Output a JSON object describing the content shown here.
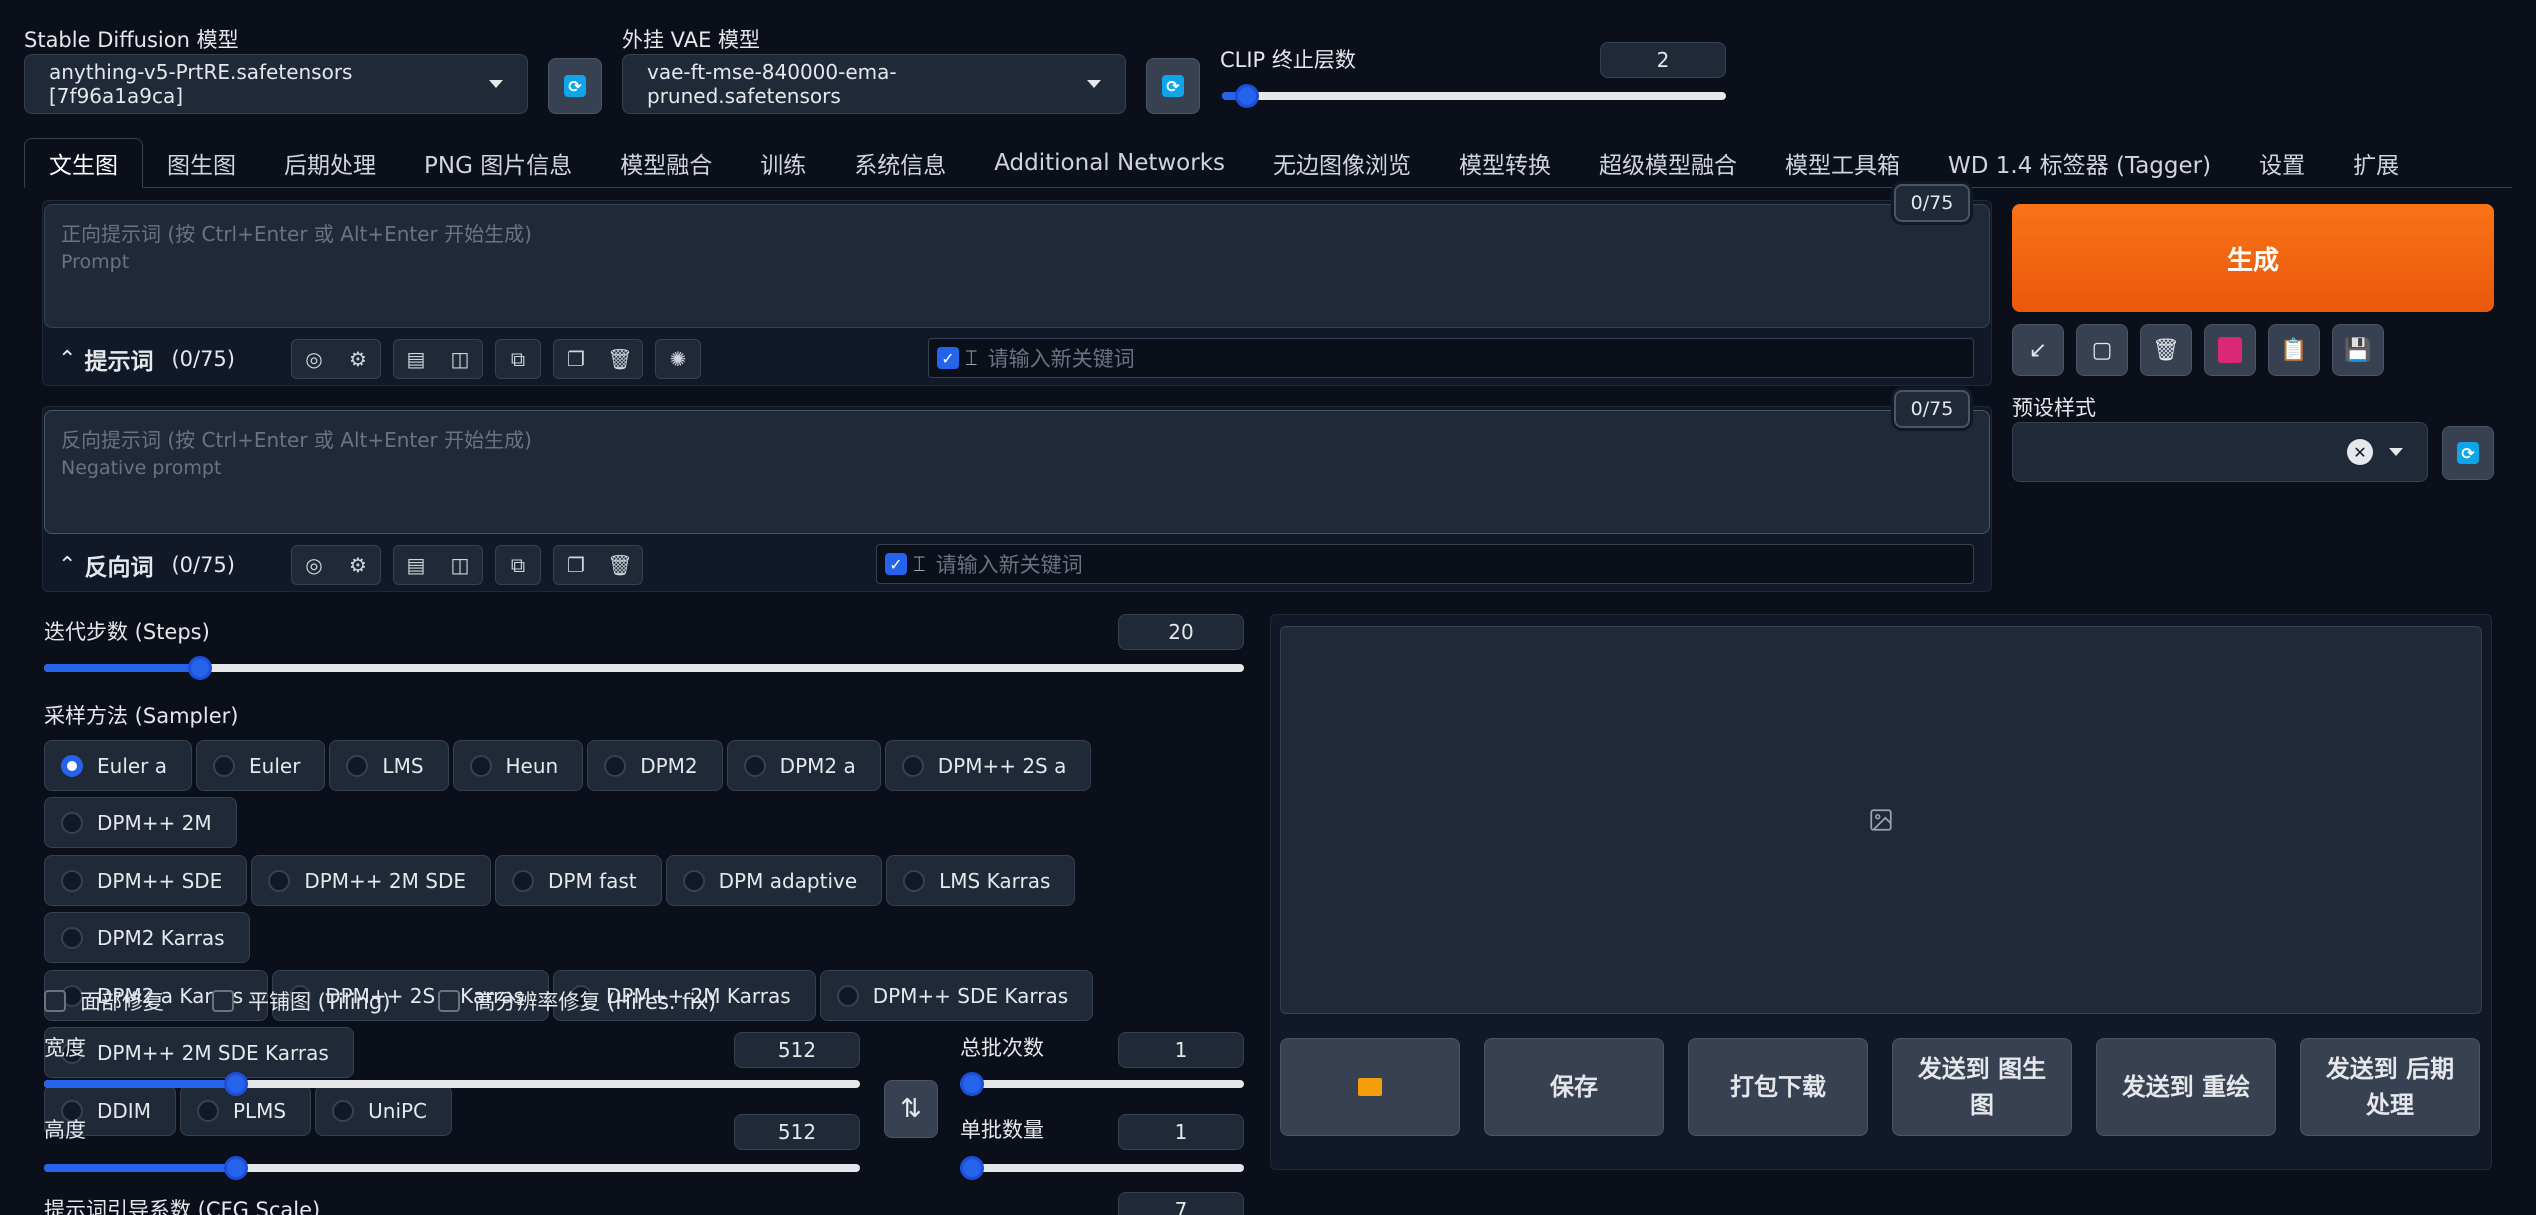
{
  "top": {
    "sd_model_label": "Stable Diffusion 模型",
    "sd_model_value": "anything-v5-PrtRE.safetensors [7f96a1a9ca]",
    "vae_label": "外挂 VAE 模型",
    "vae_value": "vae-ft-mse-840000-ema-pruned.safetensors",
    "clip_label": "CLIP 终止层数",
    "clip_value": "2",
    "clip_fraction": 0.05
  },
  "tabs": [
    {
      "label": "文生图",
      "active": true
    },
    {
      "label": "图生图"
    },
    {
      "label": "后期处理"
    },
    {
      "label": "PNG 图片信息"
    },
    {
      "label": "模型融合"
    },
    {
      "label": "训练"
    },
    {
      "label": "系统信息"
    },
    {
      "label": "Additional Networks"
    },
    {
      "label": "无边图像浏览"
    },
    {
      "label": "模型转换"
    },
    {
      "label": "超级模型融合"
    },
    {
      "label": "模型工具箱"
    },
    {
      "label": "WD 1.4 标签器 (Tagger)"
    },
    {
      "label": "设置"
    },
    {
      "label": "扩展"
    }
  ],
  "prompt": {
    "placeholder_line1": "正向提示词 (按 Ctrl+Enter 或 Alt+Enter 开始生成)",
    "placeholder_line2": "Prompt",
    "counter": "0/75",
    "title": "提示词",
    "count": "(0/75)",
    "keyword_placeholder": "请输入新关键词"
  },
  "negative": {
    "placeholder_line1": "反向提示词 (按 Ctrl+Enter 或 Alt+Enter 开始生成)",
    "placeholder_line2": "Negative prompt",
    "counter": "0/75",
    "title": "反向词",
    "count": "(0/75)",
    "keyword_placeholder": "请输入新关键词"
  },
  "generate_label": "生成",
  "styles_label": "预设样式",
  "steps": {
    "label": "迭代步数 (Steps)",
    "value": "20",
    "fraction": 0.13
  },
  "sampler": {
    "label": "采样方法 (Sampler)",
    "selected": "Euler a",
    "rows": [
      [
        "Euler a",
        "Euler",
        "LMS",
        "Heun",
        "DPM2",
        "DPM2 a",
        "DPM++ 2S a",
        "DPM++ 2M"
      ],
      [
        "DPM++ SDE",
        "DPM++ 2M SDE",
        "DPM fast",
        "DPM adaptive",
        "LMS Karras",
        "DPM2 Karras"
      ],
      [
        "DPM2 a Karras",
        "DPM++ 2S a Karras",
        "DPM++ 2M Karras",
        "DPM++ SDE Karras",
        "DPM++ 2M SDE Karras"
      ],
      [
        "DDIM",
        "PLMS",
        "UniPC"
      ]
    ]
  },
  "checks": {
    "face_restore": "面部修复",
    "tiling": "平铺图 (Tiling)",
    "hires_fix": "高分辨率修复 (Hires. fix)"
  },
  "width": {
    "label": "宽度",
    "value": "512",
    "fraction": 0.235
  },
  "height": {
    "label": "高度",
    "value": "512",
    "fraction": 0.235
  },
  "batch_count": {
    "label": "总批次数",
    "value": "1",
    "fraction": 0.0
  },
  "batch_size": {
    "label": "单批数量",
    "value": "1",
    "fraction": 0.0
  },
  "cfg": {
    "label": "提示词引导系数 (CFG Scale)",
    "value": "7"
  },
  "output_buttons": {
    "save": "保存",
    "zip": "打包下载",
    "to_img2img": "发送到 图生图",
    "to_inpaint": "发送到 重绘",
    "to_extras": "发送到 后期处理"
  }
}
